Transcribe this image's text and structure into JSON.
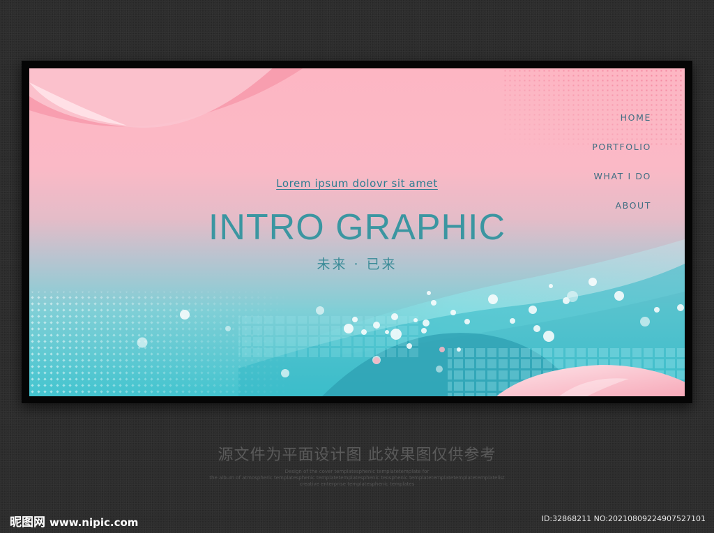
{
  "banner": {
    "subtitle": "Lorem ipsum dolovr sit amet",
    "title": "INTRO GRAPHIC",
    "chinese_tagline": "未来 · 已来"
  },
  "nav": {
    "items": [
      {
        "label": "HOME"
      },
      {
        "label": "PORTFOLIO"
      },
      {
        "label": "WHAT I DO"
      },
      {
        "label": "ABOUT"
      }
    ]
  },
  "footer": {
    "caption": "源文件为平面设计图 此效果图仅供参考",
    "fine_print": [
      "Design of the cover templatesphenic templatetemplate for",
      "the album of atmospheric templatesphenic templatetemplatesphenic teosphenic templatetemplatetemplatetemplatelist",
      "creative enterprise templatesphenic templates"
    ],
    "logo_name": "昵图网",
    "logo_url": "www.nipic.com",
    "id_text": "ID:32868211 NO:20210809224907527101"
  },
  "colors": {
    "pink_top": "#fdb6c3",
    "teal_bottom": "#43c4cf",
    "title_teal": "#3b96a1",
    "nav_text": "#3f6e82",
    "frame": "#050505",
    "backdrop": "#2d2d2d"
  }
}
